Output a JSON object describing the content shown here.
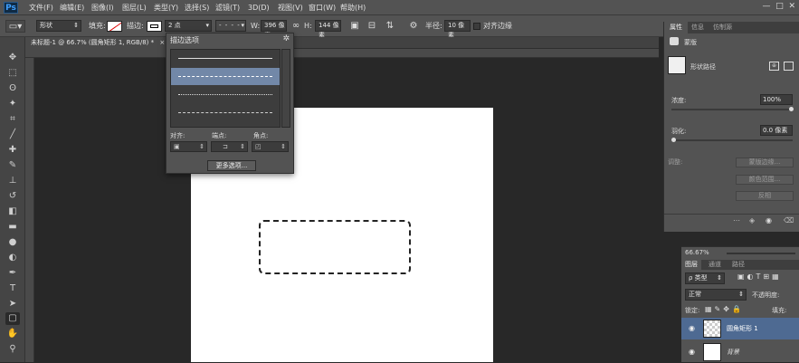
{
  "app": {
    "logo": "Ps"
  },
  "menu": [
    "文件(F)",
    "编辑(E)",
    "图像(I)",
    "图层(L)",
    "类型(Y)",
    "选择(S)",
    "滤镜(T)",
    "3D(D)",
    "视图(V)",
    "窗口(W)",
    "帮助(H)"
  ],
  "options": {
    "mode": "形状",
    "fill_label": "填充:",
    "stroke_label": "描边:",
    "stroke_width": "2 点",
    "w_label": "W:",
    "w_value": "396 像素",
    "h_label": "H:",
    "h_value": "144 像素",
    "radius_label": "半径:",
    "radius_value": "10 像素",
    "align_edges": "对齐边缘"
  },
  "document": {
    "tab_title": "未标题-1 @ 66.7% (圆角矩形 1, RGB/8) *"
  },
  "stroke_popup": {
    "title": "描边选项",
    "align_label": "对齐:",
    "caps_label": "端点:",
    "corners_label": "角点:",
    "more_button": "更多选项..."
  },
  "properties": {
    "tabs": [
      "属性",
      "信息",
      "仿制源"
    ],
    "mask_title": "蒙版",
    "path_label": "形状路径",
    "density_label": "浓度:",
    "density_value": "100%",
    "feather_label": "羽化:",
    "feather_value": "0.0 像素",
    "adjust_label": "调整:",
    "buttons": [
      "蒙版边缘...",
      "颜色范围...",
      "反相"
    ]
  },
  "layers": {
    "zoom": "66.67%",
    "tabs": [
      "图层",
      "通道",
      "路径"
    ],
    "kind": "ρ 类型",
    "blend": "正常",
    "opacity_label": "不透明度:",
    "lock_label": "锁定:",
    "fill_label": "填充:",
    "items": [
      {
        "name": "圆角矩形 1"
      },
      {
        "name": "背景"
      }
    ]
  }
}
